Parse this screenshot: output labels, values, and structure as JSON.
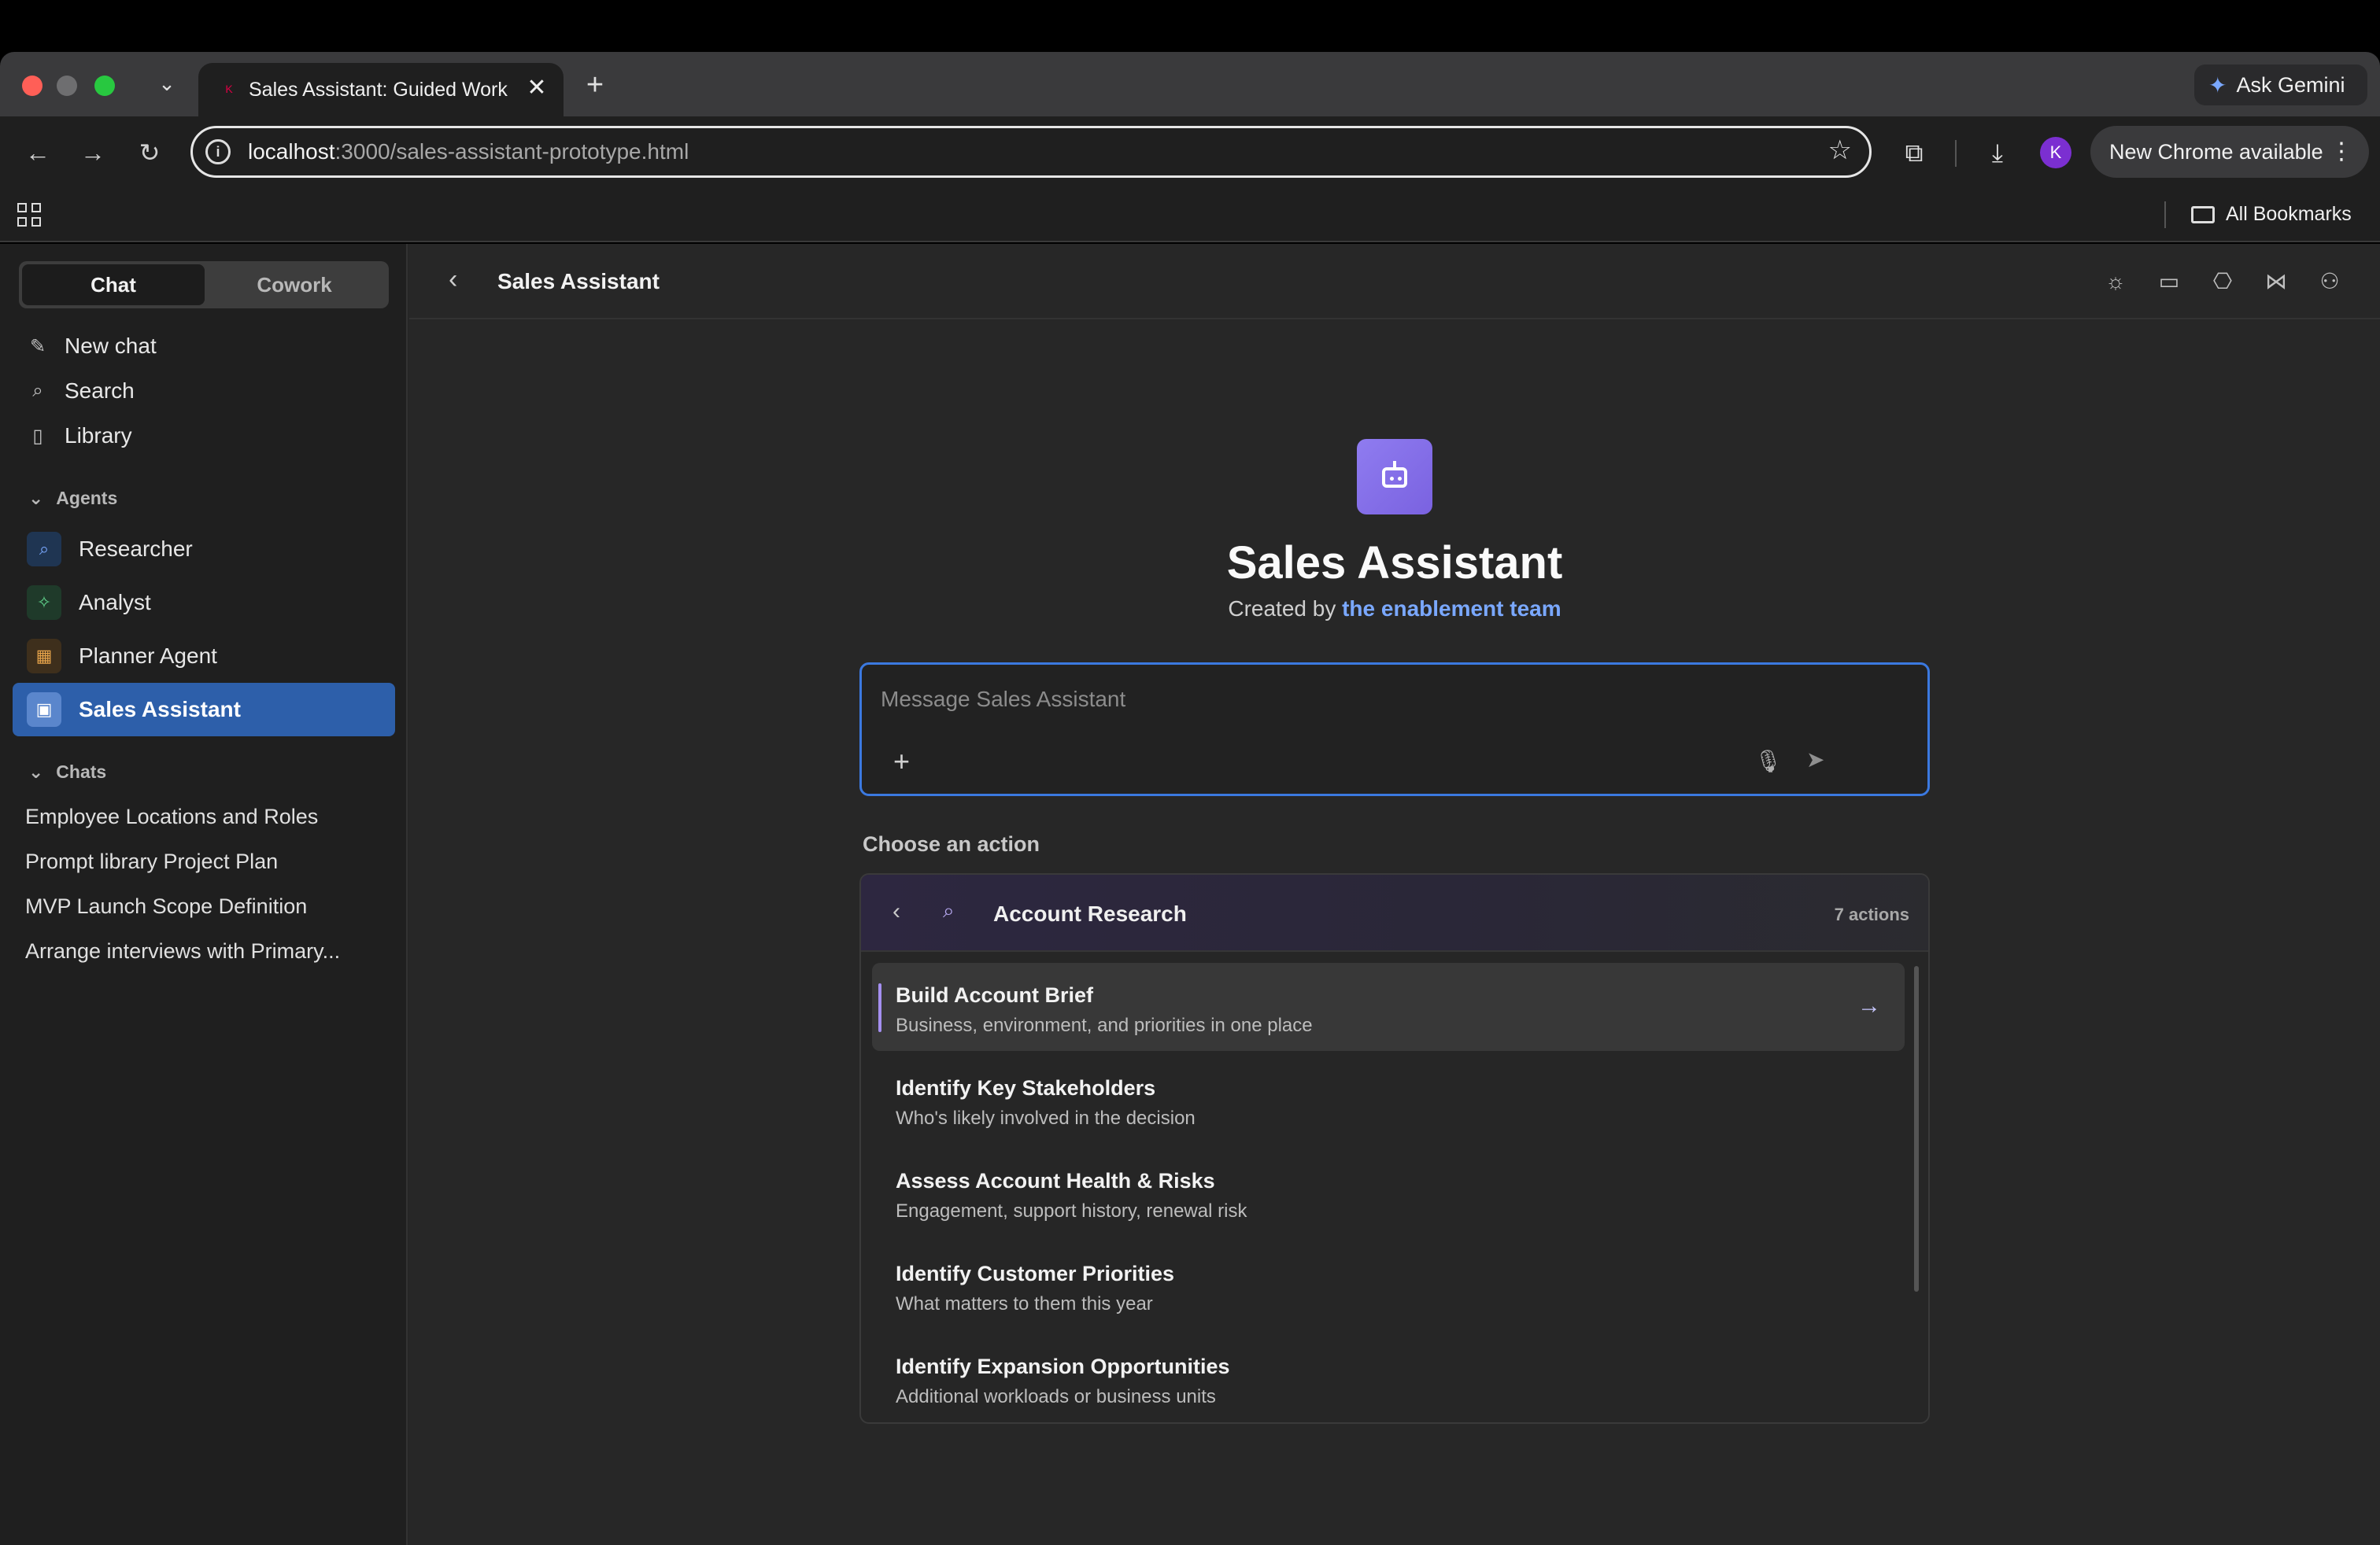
{
  "browser": {
    "tab_title": "Sales Assistant: Guided Work",
    "tab_close": "✕",
    "new_tab": "+",
    "ask_gemini": "Ask Gemini",
    "url_host": "localhost",
    "url_path": ":3000/sales-assistant-prototype.html",
    "profile_initial": "K",
    "new_chrome": "New Chrome available",
    "all_bookmarks": "All Bookmarks"
  },
  "sidebar": {
    "mode_chat": "Chat",
    "mode_cowork": "Cowork",
    "links": [
      {
        "label": "New chat",
        "icon": "pencil-icon"
      },
      {
        "label": "Search",
        "icon": "search-icon"
      },
      {
        "label": "Library",
        "icon": "book-icon"
      }
    ],
    "agents_header": "Agents",
    "agents": [
      {
        "label": "Researcher",
        "icon": "search-icon",
        "color": "#7aa8ff",
        "bg": "#1f3552"
      },
      {
        "label": "Analyst",
        "icon": "sparkle-icon",
        "color": "#5fd08a",
        "bg": "#1f3a2a"
      },
      {
        "label": "Planner Agent",
        "icon": "calendar-icon",
        "color": "#e6a34a",
        "bg": "#3e2f1c"
      },
      {
        "label": "Sales Assistant",
        "icon": "briefcase-icon",
        "color": "#ffffff",
        "bg": "#5a86cc"
      }
    ],
    "chats_header": "Chats",
    "chats": [
      "Employee Locations and Roles",
      "Prompt library Project Plan",
      "MVP Launch Scope Definition",
      "Arrange interviews with Primary..."
    ]
  },
  "main": {
    "header_title": "Sales Assistant",
    "agent_name": "Sales Assistant",
    "created_by_prefix": "Created by",
    "created_by_link": "the enablement team",
    "composer_placeholder": "Message Sales Assistant",
    "choose_label": "Choose an action",
    "panel_title": "Account Research",
    "panel_count": "7 actions",
    "actions": [
      {
        "title": "Build Account Brief",
        "desc": "Business, environment, and priorities in one place"
      },
      {
        "title": "Identify Key Stakeholders",
        "desc": "Who's likely involved in the decision"
      },
      {
        "title": "Assess Account Health & Risks",
        "desc": "Engagement, support history, renewal risk"
      },
      {
        "title": "Identify Customer Priorities",
        "desc": "What matters to them this year"
      },
      {
        "title": "Identify Expansion Opportunities",
        "desc": "Additional workloads or business units"
      }
    ]
  },
  "colors": {
    "accent": "#3b79e0",
    "active_agent": "#2d5faa",
    "link": "#7aa8ff",
    "bot_avatar": "#8f7cf0"
  }
}
